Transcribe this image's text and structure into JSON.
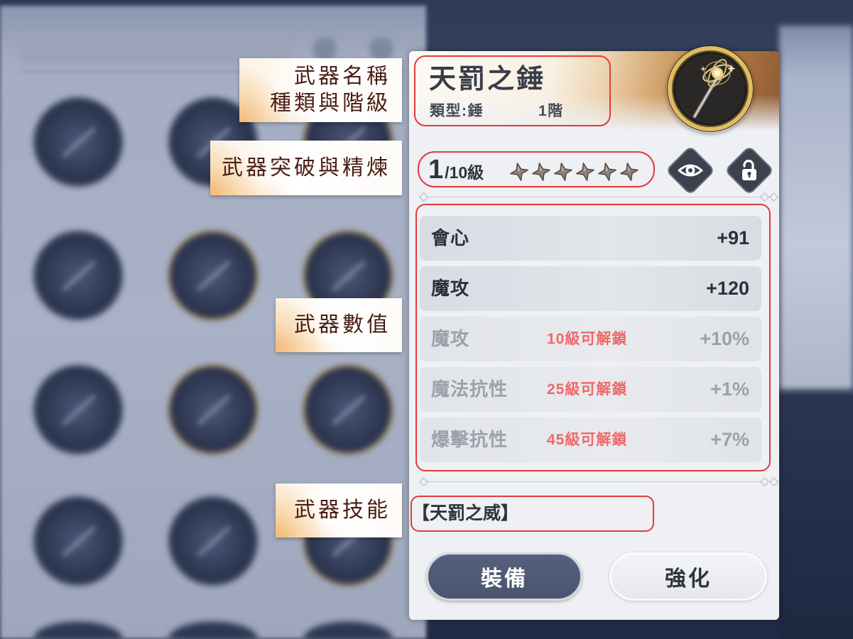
{
  "annotations": {
    "name_label": [
      "武器名稱",
      "種類與階級"
    ],
    "breakthrough_label": "武器突破與精煉",
    "stats_label": "武器數值",
    "skill_label": "武器技能"
  },
  "weapon": {
    "name": "天罰之錘",
    "type": "類型:錘",
    "tier": "1階",
    "portrait_icon": "staff-orb-icon",
    "level": "1",
    "level_max": "/10級",
    "refine_stars": 6,
    "view_button_icon": "eye-icon",
    "lock_button_icon": "unlocked-padlock-icon"
  },
  "stats": [
    {
      "name": "會心",
      "value": "+91",
      "locked": false
    },
    {
      "name": "魔攻",
      "value": "+120",
      "locked": false
    },
    {
      "name": "魔攻",
      "value": "+10%",
      "locked": true,
      "unlock_hint": "10級可解鎖"
    },
    {
      "name": "魔法抗性",
      "value": "+1%",
      "locked": true,
      "unlock_hint": "25級可解鎖"
    },
    {
      "name": "爆擊抗性",
      "value": "+7%",
      "locked": true,
      "unlock_hint": "45級可解鎖"
    }
  ],
  "skill": {
    "name": "【天罰之威】"
  },
  "buttons": {
    "equip": "裝備",
    "enhance": "強化"
  },
  "colors": {
    "highlight_outline": "#e23b3b",
    "unlock_hint": "#f06868",
    "annotation_text": "#4a1d12",
    "header_accent": "#b57a45",
    "equip_button": "#4b5570"
  }
}
